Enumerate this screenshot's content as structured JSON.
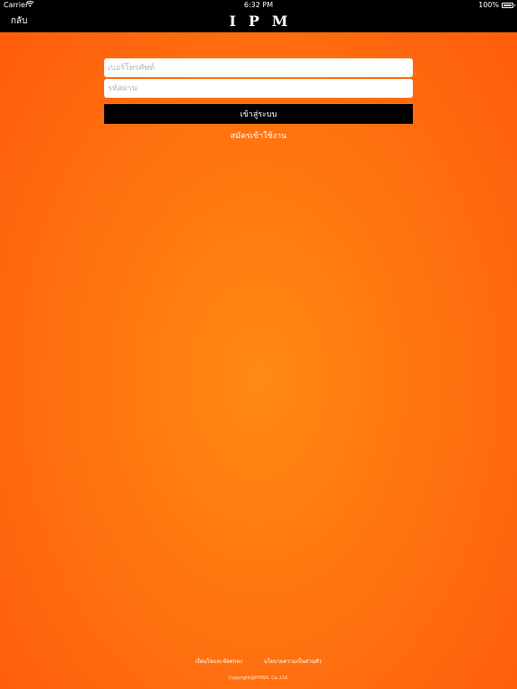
{
  "status_bar": {
    "carrier": "Carrier",
    "wifi_icon": "wifi-icon",
    "time": "6:32 PM",
    "battery": "100%",
    "battery_icon": "battery-icon"
  },
  "nav": {
    "back_label": "กลับ",
    "logo_text": "IPM"
  },
  "login_form": {
    "phone_placeholder": "เบอร์โทรศัพท์",
    "password_placeholder": "รหัสผ่าน",
    "login_button": "เข้าสู่ระบบ",
    "register_link": "สมัครเข้าใช้งาน"
  },
  "footer": {
    "terms_link": "เงื่อนไขและข้อตกลง",
    "privacy_link": "นโยบายความเป็นส่วนตัว",
    "copyright": "Copyright@IPMSS. Co.,Ltd."
  },
  "colors": {
    "background_center": "#ff8a12",
    "background_edge": "#ff5a0c",
    "bar": "#000000",
    "field": "#ffffff"
  }
}
